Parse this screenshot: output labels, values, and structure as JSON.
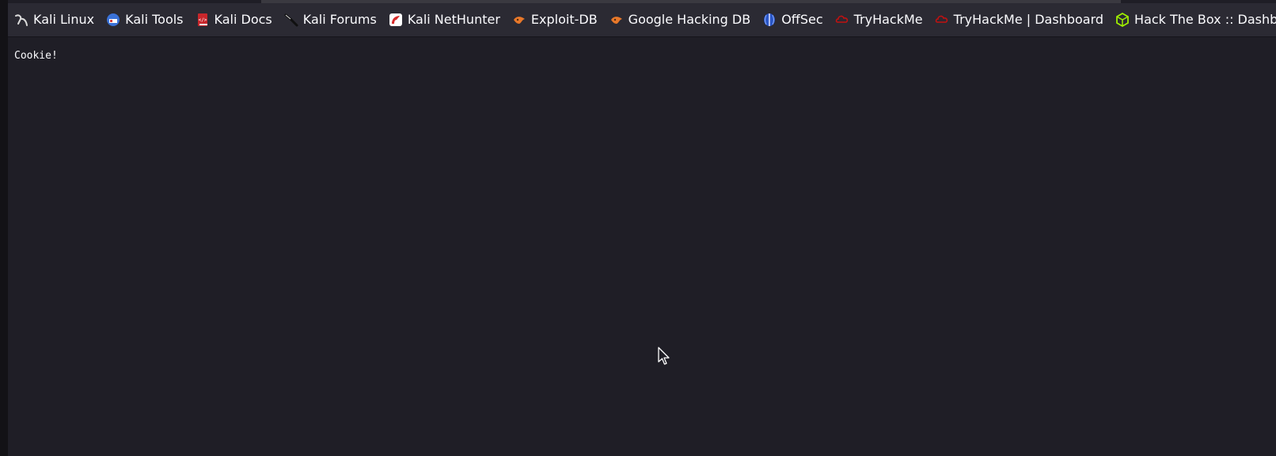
{
  "bookmarks": [
    {
      "label": "Kali Linux",
      "icon": "kali-dragon-icon"
    },
    {
      "label": "Kali Tools",
      "icon": "kali-tools-icon"
    },
    {
      "label": "Kali Docs",
      "icon": "kali-docs-icon"
    },
    {
      "label": "Kali Forums",
      "icon": "kali-forums-icon"
    },
    {
      "label": "Kali NetHunter",
      "icon": "nethunter-icon"
    },
    {
      "label": "Exploit-DB",
      "icon": "exploit-db-icon"
    },
    {
      "label": "Google Hacking DB",
      "icon": "ghdb-icon"
    },
    {
      "label": "OffSec",
      "icon": "offsec-icon"
    },
    {
      "label": "TryHackMe",
      "icon": "tryhackme-icon"
    },
    {
      "label": "TryHackMe | Dashboard",
      "icon": "tryhackme-icon"
    },
    {
      "label": "Hack The Box :: Dashb...",
      "icon": "hackthebox-icon"
    }
  ],
  "page": {
    "body_text": "Cookie!"
  },
  "colors": {
    "toolbar_bg": "#2b2a33",
    "page_bg": "#1f1e26",
    "text": "#fbfbfe",
    "exploit_orange": "#e8782a",
    "htb_green": "#9fef00",
    "thm_red": "#c11111"
  }
}
